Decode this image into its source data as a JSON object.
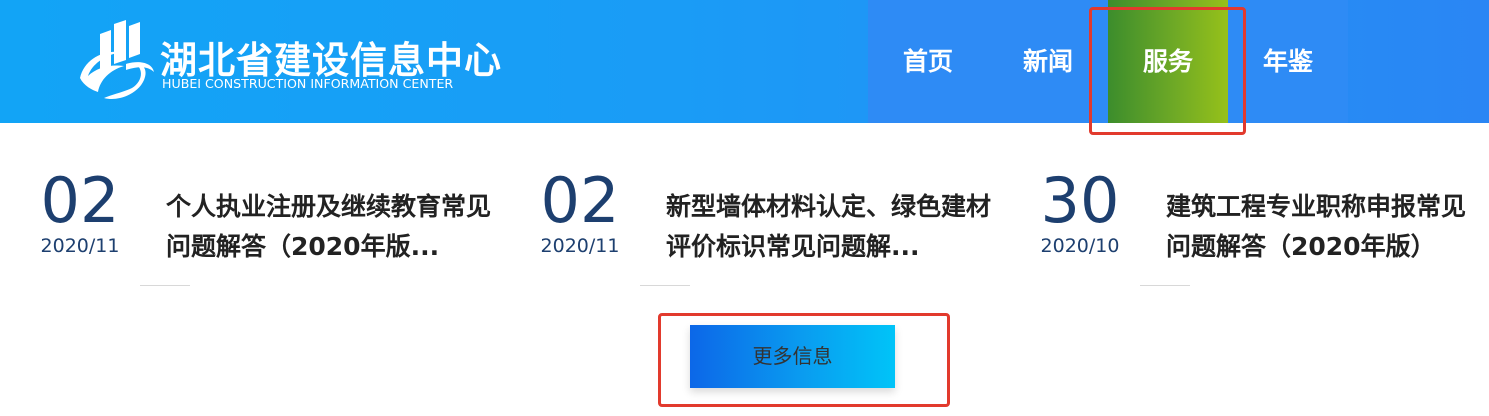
{
  "header": {
    "logo_cn": "湖北省建设信息中心",
    "logo_en": "HUBEI CONSTRUCTION INFORMATION CENTER",
    "nav": [
      {
        "label": "首页",
        "active": false
      },
      {
        "label": "新闻",
        "active": false
      },
      {
        "label": "服务",
        "active": true
      },
      {
        "label": "年鉴",
        "active": false
      }
    ]
  },
  "news": [
    {
      "day": "02",
      "year_month": "2020/11",
      "title": "个人执业注册及继续教育常见问题解答（2020年版..."
    },
    {
      "day": "02",
      "year_month": "2020/11",
      "title": "新型墙体材料认定、绿色建材评价标识常见问题解..."
    },
    {
      "day": "30",
      "year_month": "2020/10",
      "title": "建筑工程专业职称申报常见问题解答（2020年版）"
    }
  ],
  "more_button": "更多信息",
  "colors": {
    "header_blue": "#12a4f6",
    "nav_blue": "#2e8bf5",
    "active_green": "#6ea926",
    "date_navy": "#1d3f6f",
    "highlight_red": "#e23a2d"
  }
}
